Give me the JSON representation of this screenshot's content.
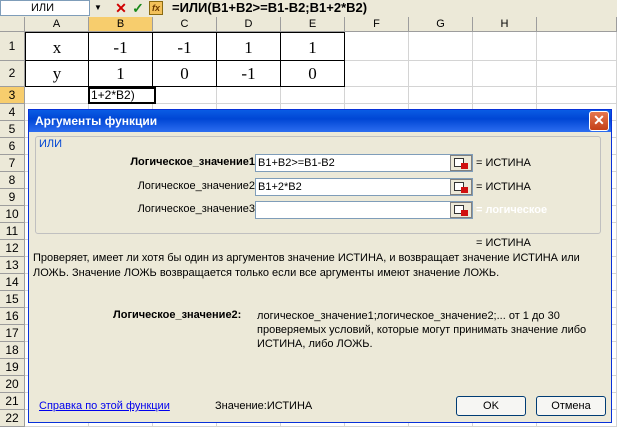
{
  "formula_bar": {
    "name_box": "ИЛИ",
    "formula": "=ИЛИ(B1+B2>=B1-B2;B1+2*B2)",
    "fx_label": "fx"
  },
  "sheet": {
    "columns": [
      "A",
      "B",
      "C",
      "D",
      "E",
      "F",
      "G",
      "H"
    ],
    "rows": [
      "1",
      "2",
      "3",
      "4",
      "5",
      "6",
      "7",
      "8",
      "9",
      "10",
      "11",
      "12",
      "13",
      "14",
      "15",
      "16",
      "17",
      "18",
      "19",
      "20",
      "21",
      "22"
    ],
    "cells": [
      [
        "x",
        "-1",
        "-1",
        "1",
        "1"
      ],
      [
        "y",
        "1",
        "0",
        "-1",
        "0"
      ]
    ],
    "b3_edit_text": "1+2*B2)"
  },
  "dialog": {
    "title": "Аргументы функции",
    "close": "✕",
    "function_name": "ИЛИ",
    "args": [
      {
        "label": "Логическое_значение1",
        "value": "B1+B2>=B1-B2",
        "result": "= ИСТИНА"
      },
      {
        "label": "Логическое_значение2",
        "value": "B1+2*B2",
        "result": "= ИСТИНА"
      },
      {
        "label": "Логическое_значение3",
        "value": "",
        "result": "= логическое"
      }
    ],
    "total_result": "= ИСТИНА",
    "description": "Проверяет, имеет ли хотя бы один из аргументов значение ИСТИНА, и возвращает значение ИСТИНА или ЛОЖЬ. Значение ЛОЖЬ возвращается только если все аргументы имеют значение ЛОЖЬ.",
    "param_label": "Логическое_значение2:",
    "param_description": "логическое_значение1;логическое_значение2;... от 1 до 30 проверяемых условий, которые могут принимать значение либо ИСТИНА, либо ЛОЖЬ.",
    "help_link": "Справка по этой функции",
    "value_text": "Значение:ИСТИНА",
    "ok": "OK",
    "cancel": "Отмена"
  }
}
